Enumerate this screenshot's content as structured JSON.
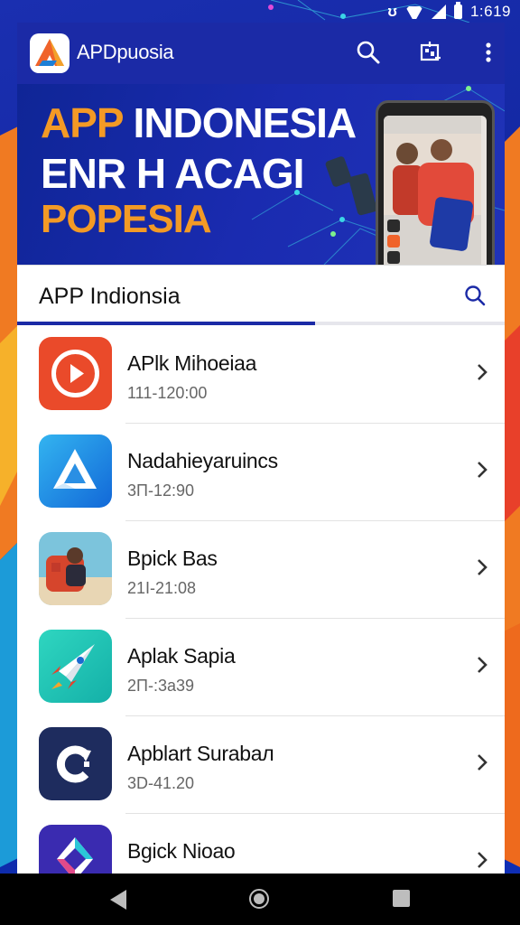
{
  "status_bar": {
    "time": "1:619",
    "vibrate_icon": "vibrate-icon",
    "wifi_icon": "wifi-icon",
    "signal_icon": "signal-icon",
    "battery_icon": "battery-icon"
  },
  "app_bar": {
    "title": "APDpuosia",
    "logo_icon": "app-logo-icon",
    "actions": [
      "search-icon",
      "qr-scan-icon",
      "more-vert-icon"
    ]
  },
  "banner": {
    "line1_part1": "APP",
    "line1_part2": "INDONESIA",
    "line2": "ENR H ACAGI",
    "line3": "POPESIA"
  },
  "section": {
    "title": "APP Indionsia",
    "search_icon": "search-icon"
  },
  "apps": [
    {
      "name": "APlk Mihoeiaa",
      "meta": "111-120:00",
      "icon": "play-app-icon",
      "color": "#ea4a2a"
    },
    {
      "name": "Nadahieyaruincs",
      "meta": "3П-12:90",
      "icon": "triangle-app-icon",
      "color": "#1f8fe0"
    },
    {
      "name": "Bpick Bas",
      "meta": "21І-21:08",
      "icon": "photo-app-icon",
      "color": "#5aa6c8"
    },
    {
      "name": "Aplak Sapia",
      "meta": "2П-:3a39",
      "icon": "rocket-app-icon",
      "color": "#22c2b2"
    },
    {
      "name": "Apblart Surabaл",
      "meta": "3D-41.20",
      "icon": "refresh-app-icon",
      "color": "#1e2c5e"
    },
    {
      "name": "Bgick Nioao",
      "meta": "",
      "icon": "diamond-app-icon",
      "color": "#3a2bb0"
    }
  ],
  "nav_bar": {
    "back_icon": "back-icon",
    "home_icon": "home-icon",
    "recents_icon": "recents-icon"
  },
  "colors": {
    "primary": "#1b2aa6",
    "accent": "#f39a25",
    "background": "#0e1f8a"
  }
}
